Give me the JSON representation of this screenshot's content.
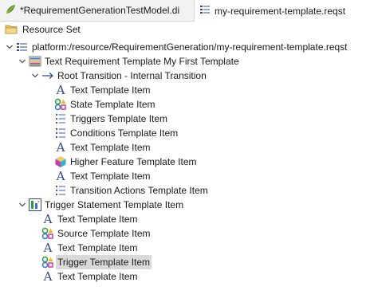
{
  "tabs": [
    {
      "label": "*RequirementGenerationTestModel.di",
      "icon": "leaf-model-icon"
    },
    {
      "label": "my-requirement-template.reqst",
      "icon": "requirement-template-file-icon"
    }
  ],
  "toolbar": {
    "label": "Resource Set",
    "icon": "folder-icon"
  },
  "tree": [
    {
      "label": "platform:/resource/RequirementGeneration/my-requirement-template.reqst",
      "icon": "resource-file-icon",
      "depth": 0,
      "expanded": true
    },
    {
      "label": "Text Requirement Template My First Template",
      "icon": "template-icon",
      "depth": 1,
      "expanded": true
    },
    {
      "label": "Root Transition - Internal Transition",
      "icon": "transition-arrow-icon",
      "depth": 2,
      "expanded": true
    },
    {
      "label": "Text Template Item",
      "icon": "text-item-icon",
      "depth": 3
    },
    {
      "label": "State Template Item",
      "icon": "state-item-icon",
      "depth": 3
    },
    {
      "label": "Triggers Template Item",
      "icon": "list-item-icon",
      "depth": 3
    },
    {
      "label": "Conditions Template Item",
      "icon": "list-item-icon",
      "depth": 3
    },
    {
      "label": "Text Template Item",
      "icon": "text-item-icon",
      "depth": 3
    },
    {
      "label": "Higher Feature Template Item",
      "icon": "cube-icon",
      "depth": 3
    },
    {
      "label": "Text Template Item",
      "icon": "text-item-icon",
      "depth": 3
    },
    {
      "label": "Transition Actions Template Item",
      "icon": "list-item-icon",
      "depth": 3
    },
    {
      "label": "Trigger Statement Template Item",
      "icon": "trigger-statement-icon",
      "depth": 1,
      "expanded": true
    },
    {
      "label": "Text Template Item",
      "icon": "text-item-icon",
      "depth": 2
    },
    {
      "label": "Source Template Item",
      "icon": "state-item-icon",
      "depth": 2
    },
    {
      "label": "Text Template Item",
      "icon": "text-item-icon",
      "depth": 2
    },
    {
      "label": "Trigger Template Item",
      "icon": "state-item-icon",
      "depth": 2,
      "selected": true
    },
    {
      "label": "Text Template Item",
      "icon": "text-item-icon",
      "depth": 2
    }
  ]
}
